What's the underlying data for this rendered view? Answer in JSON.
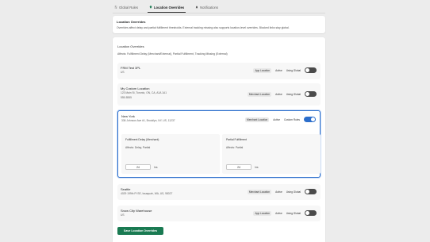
{
  "tabs": [
    {
      "label": "Global Rules",
      "icon": "sliders-icon",
      "active": false
    },
    {
      "label": "Location Overrides",
      "icon": "pin-icon",
      "active": true
    },
    {
      "label": "Notifications",
      "icon": "bell-icon",
      "active": false
    }
  ],
  "info": {
    "title": "Location Overrides",
    "text": "Overrides affect delay and partial fulfillment thresholds. External tracking missing also supports location-level overrides. Blocked links stay global."
  },
  "section": {
    "title": "Location Overrides",
    "affects": "Affects: Fulfillment Delay (Merchant/External), Partial Fulfillment, Tracking Missing (External)"
  },
  "locations": [
    {
      "name": "FRM Test 3PL",
      "address": "US",
      "phone": "",
      "type": "App Location",
      "status": "Active",
      "mode": "Using Global",
      "override": false
    },
    {
      "name": "My Custom Location",
      "address": "123 Main St, Toronto, ON, CA, A1A 1A1",
      "phone": "555-5555",
      "type": "Merchant Location",
      "status": "Active",
      "mode": "Using Global",
      "override": false
    },
    {
      "name": "New York",
      "address": "336 Johnson Ave #1, Brooklyn, NY, US, 11237",
      "phone": "",
      "type": "Merchant Location",
      "status": "Active",
      "mode": "Custom Rules",
      "override": true
    },
    {
      "name": "Seattle",
      "address": "4029 199th Pl SE, Issaquah, WA, US, 98027",
      "phone": "",
      "type": "Merchant Location",
      "status": "Active",
      "mode": "Using Global",
      "override": false
    },
    {
      "name": "Snow City Warehouse",
      "address": "US",
      "phone": "",
      "type": "App Location",
      "status": "Active",
      "mode": "Using Global",
      "override": false
    }
  ],
  "custom_rules": {
    "delay": {
      "title": "Fulfillment Delay (Merchant)",
      "affects": "Affects: Delay, Partial",
      "value": "24",
      "unit": "hrs"
    },
    "partial": {
      "title": "Partial Fulfillment",
      "affects": "Affects: Partial",
      "value": "24",
      "unit": "hrs"
    }
  },
  "save_label": "Save Location Overrides",
  "colors": {
    "accent": "#2c6ecb",
    "save": "#1a7a52",
    "toggle_off": "#4a4a4a"
  }
}
